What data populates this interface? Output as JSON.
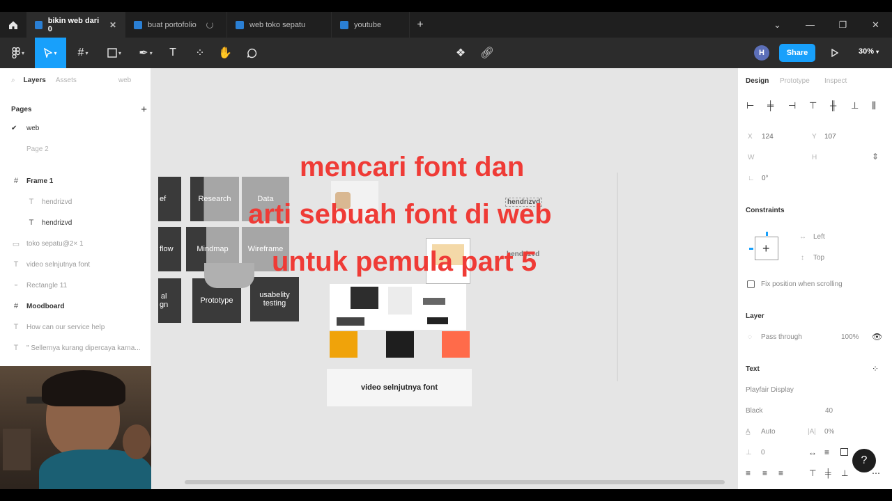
{
  "tabs": [
    {
      "label": "bikin web dari 0",
      "active": true
    },
    {
      "label": "buat portofolio",
      "loading": true
    },
    {
      "label": "web toko sepatu"
    },
    {
      "label": "youtube"
    }
  ],
  "toolbar": {
    "avatar_initial": "H",
    "share_label": "Share",
    "zoom": "30%"
  },
  "left": {
    "tabs": {
      "layers": "Layers",
      "assets": "Assets",
      "page": "web"
    },
    "pages_header": "Pages",
    "pages": [
      "web",
      "Page 2"
    ],
    "layers": [
      {
        "label": "Frame 1",
        "icon": "frame",
        "indent": 0,
        "bold": true
      },
      {
        "label": "hendrizvd",
        "icon": "text",
        "indent": 1,
        "faded": true
      },
      {
        "label": "hendrizvd",
        "icon": "text",
        "indent": 1,
        "bold": false
      },
      {
        "label": "toko sepatu@2× 1",
        "icon": "image",
        "indent": 0,
        "faded": true
      },
      {
        "label": "video selnjutnya font",
        "icon": "text",
        "indent": 0,
        "faded": true
      },
      {
        "label": "Rectangle 11",
        "icon": "rect",
        "indent": 0,
        "faded": true
      },
      {
        "label": "Moodboard",
        "icon": "frame",
        "indent": 0,
        "bold": true
      },
      {
        "label": "How can our service help",
        "icon": "text",
        "indent": 0,
        "faded": true
      },
      {
        "label": "\" Sellernya kurang dipercaya karna...",
        "icon": "text",
        "indent": 0,
        "faded": true
      }
    ]
  },
  "canvas": {
    "cards": [
      "ef",
      "Research",
      "Data",
      "flow",
      "Mindmap",
      "Wireframe",
      "al\ngn",
      "Prototype",
      "usabelity\ntesting"
    ],
    "hendrizvd_1": "hendrizvd",
    "hendrizvd_2": "hendrizvd",
    "video_text": "video selnjutnya font",
    "overlay": [
      "mencari font dan",
      "arti sebuah font di web",
      "untuk pemula part 5"
    ],
    "swatches": [
      "#f0a30a",
      "#1e1e1e",
      "#ff6b4a"
    ]
  },
  "right": {
    "tabs": {
      "design": "Design",
      "prototype": "Prototype",
      "inspect": "Inspect"
    },
    "x_label": "X",
    "x": "124",
    "y_label": "Y",
    "y": "107",
    "w_label": "W",
    "h_label": "H",
    "rotation": "0°",
    "constraints_header": "Constraints",
    "constraint_h": "Left",
    "constraint_v": "Top",
    "fix_position": "Fix position when scrolling",
    "layer_header": "Layer",
    "blend": "Pass through",
    "opacity": "100%",
    "text_header": "Text",
    "font_family": "Playfair Display",
    "font_weight": "Black",
    "font_size": "40",
    "line_height": "Auto",
    "letter_spacing": "0%",
    "paragraph_spacing": "0"
  },
  "help": "?"
}
